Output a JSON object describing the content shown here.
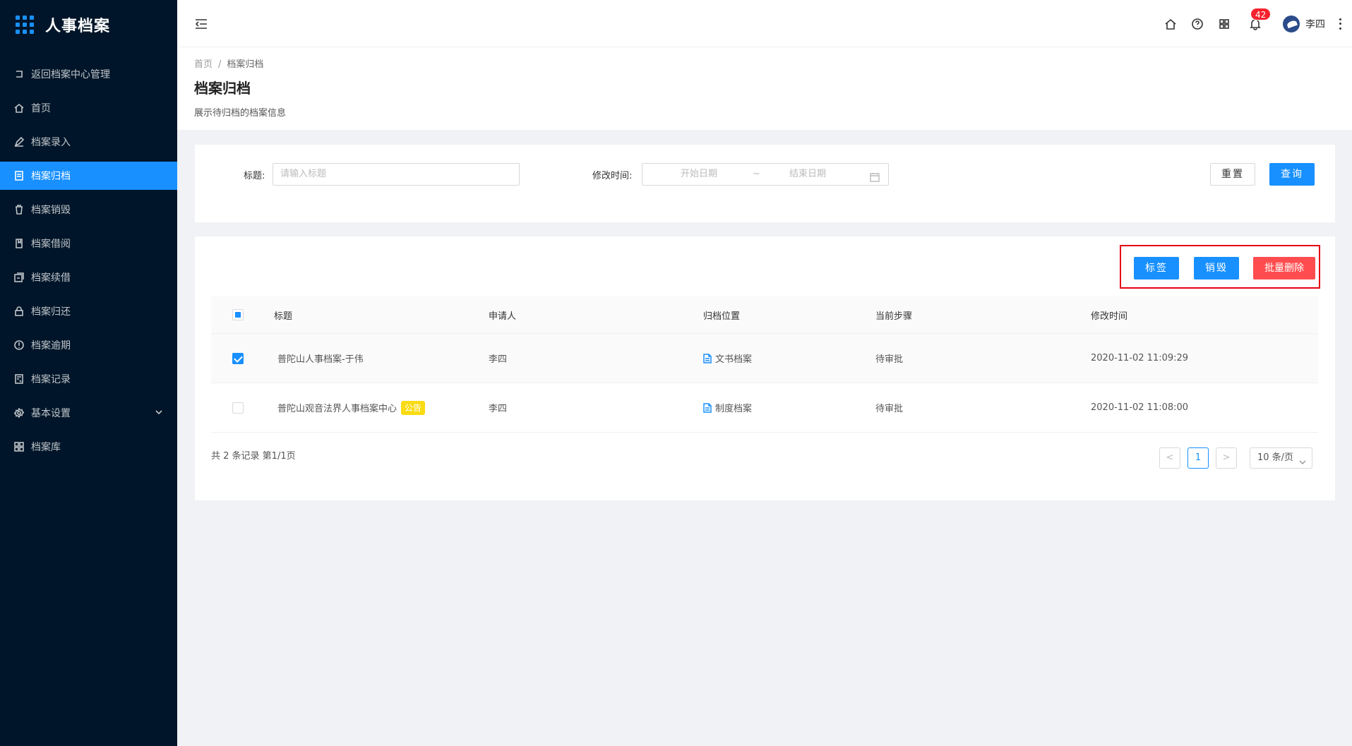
{
  "app": {
    "title": "人事档案"
  },
  "sidebar": {
    "items": [
      {
        "label": "返回档案中心管理",
        "icon": "return-icon"
      },
      {
        "label": "首页",
        "icon": "home-icon"
      },
      {
        "label": "档案录入",
        "icon": "edit-icon"
      },
      {
        "label": "档案归档",
        "icon": "archive-icon",
        "active": true
      },
      {
        "label": "档案销毁",
        "icon": "trash-icon"
      },
      {
        "label": "档案借阅",
        "icon": "book-icon"
      },
      {
        "label": "档案续借",
        "icon": "renew-icon"
      },
      {
        "label": "档案归还",
        "icon": "lock-icon"
      },
      {
        "label": "档案逾期",
        "icon": "clock-alert-icon"
      },
      {
        "label": "档案记录",
        "icon": "record-icon"
      },
      {
        "label": "基本设置",
        "icon": "gear-icon"
      },
      {
        "label": "档案库",
        "icon": "grid-icon"
      }
    ]
  },
  "header": {
    "notification_count": "42",
    "username": "李四"
  },
  "breadcrumb": {
    "home": "首页",
    "separator": "/",
    "current": "档案归档"
  },
  "page": {
    "title": "档案归档",
    "description": "展示待归档的档案信息"
  },
  "search": {
    "title_label": "标题:",
    "title_placeholder": "请输入标题",
    "time_label": "修改时间:",
    "start_placeholder": "开始日期",
    "range_sep": "~",
    "end_placeholder": "结束日期",
    "reset_label": "重置",
    "query_label": "查询"
  },
  "actions": {
    "tag_label": "标签",
    "destroy_label": "销毁",
    "batch_delete_label": "批量删除"
  },
  "table": {
    "columns": [
      "标题",
      "申请人",
      "归档位置",
      "当前步骤",
      "修改时间"
    ],
    "rows": [
      {
        "checked": true,
        "title": "普陀山人事档案-于伟",
        "tag": "",
        "applicant": "李四",
        "location": "文书档案",
        "step": "待审批",
        "modified": "2020-11-02 11:09:29"
      },
      {
        "checked": false,
        "title": "普陀山观音法界人事档案中心",
        "tag": "公告",
        "applicant": "李四",
        "location": "制度档案",
        "step": "待审批",
        "modified": "2020-11-02 11:08:00"
      }
    ]
  },
  "pagination": {
    "summary": "共 2 条记录 第1/1页",
    "current_page": "1",
    "page_size": "10 条/页"
  },
  "colors": {
    "primary": "#1890ff",
    "danger": "#ff4d4f",
    "sidebar_bg": "#001529",
    "highlight_box": "#e60012",
    "tag_yellow": "#fadb14"
  }
}
